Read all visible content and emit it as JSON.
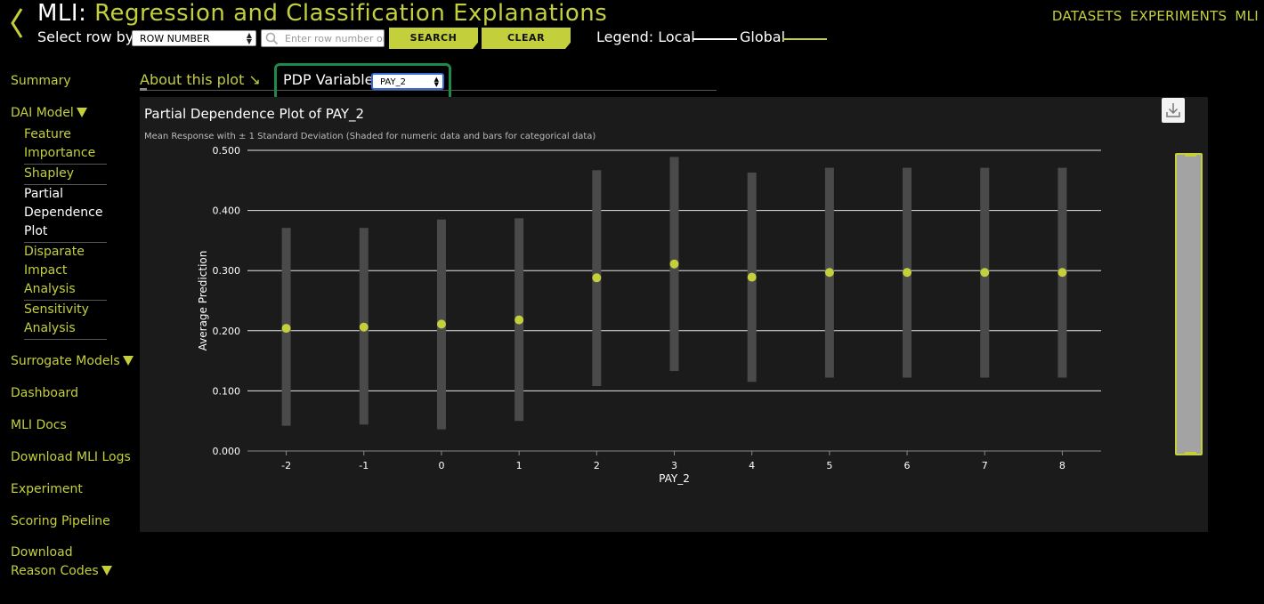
{
  "header": {
    "title_prefix": "MLI:",
    "title_main": "Regression and Classification Explanations",
    "select_row_label": "Select row by:",
    "row_select_value": "ROW NUMBER",
    "row_input_placeholder": "Enter row number or",
    "search_label": "SEARCH",
    "clear_label": "CLEAR",
    "legend_label": "Legend: Local",
    "legend_global": "Global"
  },
  "topnav": [
    "DATASETS",
    "EXPERIMENTS",
    "MLI"
  ],
  "sidebar": {
    "summary": "Summary",
    "dai_model": "DAI Model",
    "dai_sub": [
      {
        "label": "Feature Importance",
        "active": false
      },
      {
        "label": "Shapley",
        "active": false
      },
      {
        "label": "Partial Dependence Plot",
        "active": true
      },
      {
        "label": "Disparate Impact Analysis",
        "active": false
      },
      {
        "label": "Sensitivity Analysis",
        "active": false
      }
    ],
    "surrogate": "Surrogate Models",
    "dashboard": "Dashboard",
    "mli_docs": "MLI Docs",
    "download_logs": "Download MLI Logs",
    "experiment": "Experiment",
    "scoring_pipeline": "Scoring Pipeline",
    "download_reason": "Download Reason Codes"
  },
  "panel": {
    "about_label": "About this plot ↘",
    "pdp_label": "PDP Variable:",
    "pdp_value": "PAY_2"
  },
  "colors": {
    "accent": "#c4cf3c",
    "highlight": "#1e8a4a"
  },
  "chart_data": {
    "type": "scatter",
    "title": "Partial Dependence Plot of PAY_2",
    "subtitle": "Mean Response with ± 1 Standard Deviation (Shaded for numeric data and bars for categorical data)",
    "xlabel": "PAY_2",
    "ylabel": "Average Prediction",
    "ylim": [
      0,
      0.5
    ],
    "yticks": [
      "0.000",
      "0.100",
      "0.200",
      "0.300",
      "0.400",
      "0.500"
    ],
    "grid": true,
    "categories": [
      "-2",
      "-1",
      "0",
      "1",
      "2",
      "3",
      "4",
      "5",
      "6",
      "7",
      "8"
    ],
    "mean": [
      0.204,
      0.206,
      0.211,
      0.218,
      0.288,
      0.311,
      0.289,
      0.297,
      0.297,
      0.297,
      0.297
    ],
    "lower": [
      0.042,
      0.044,
      0.036,
      0.05,
      0.108,
      0.133,
      0.115,
      0.122,
      0.122,
      0.122,
      0.122
    ],
    "upper": [
      0.371,
      0.371,
      0.385,
      0.387,
      0.467,
      0.489,
      0.463,
      0.471,
      0.471,
      0.471,
      0.471
    ]
  }
}
